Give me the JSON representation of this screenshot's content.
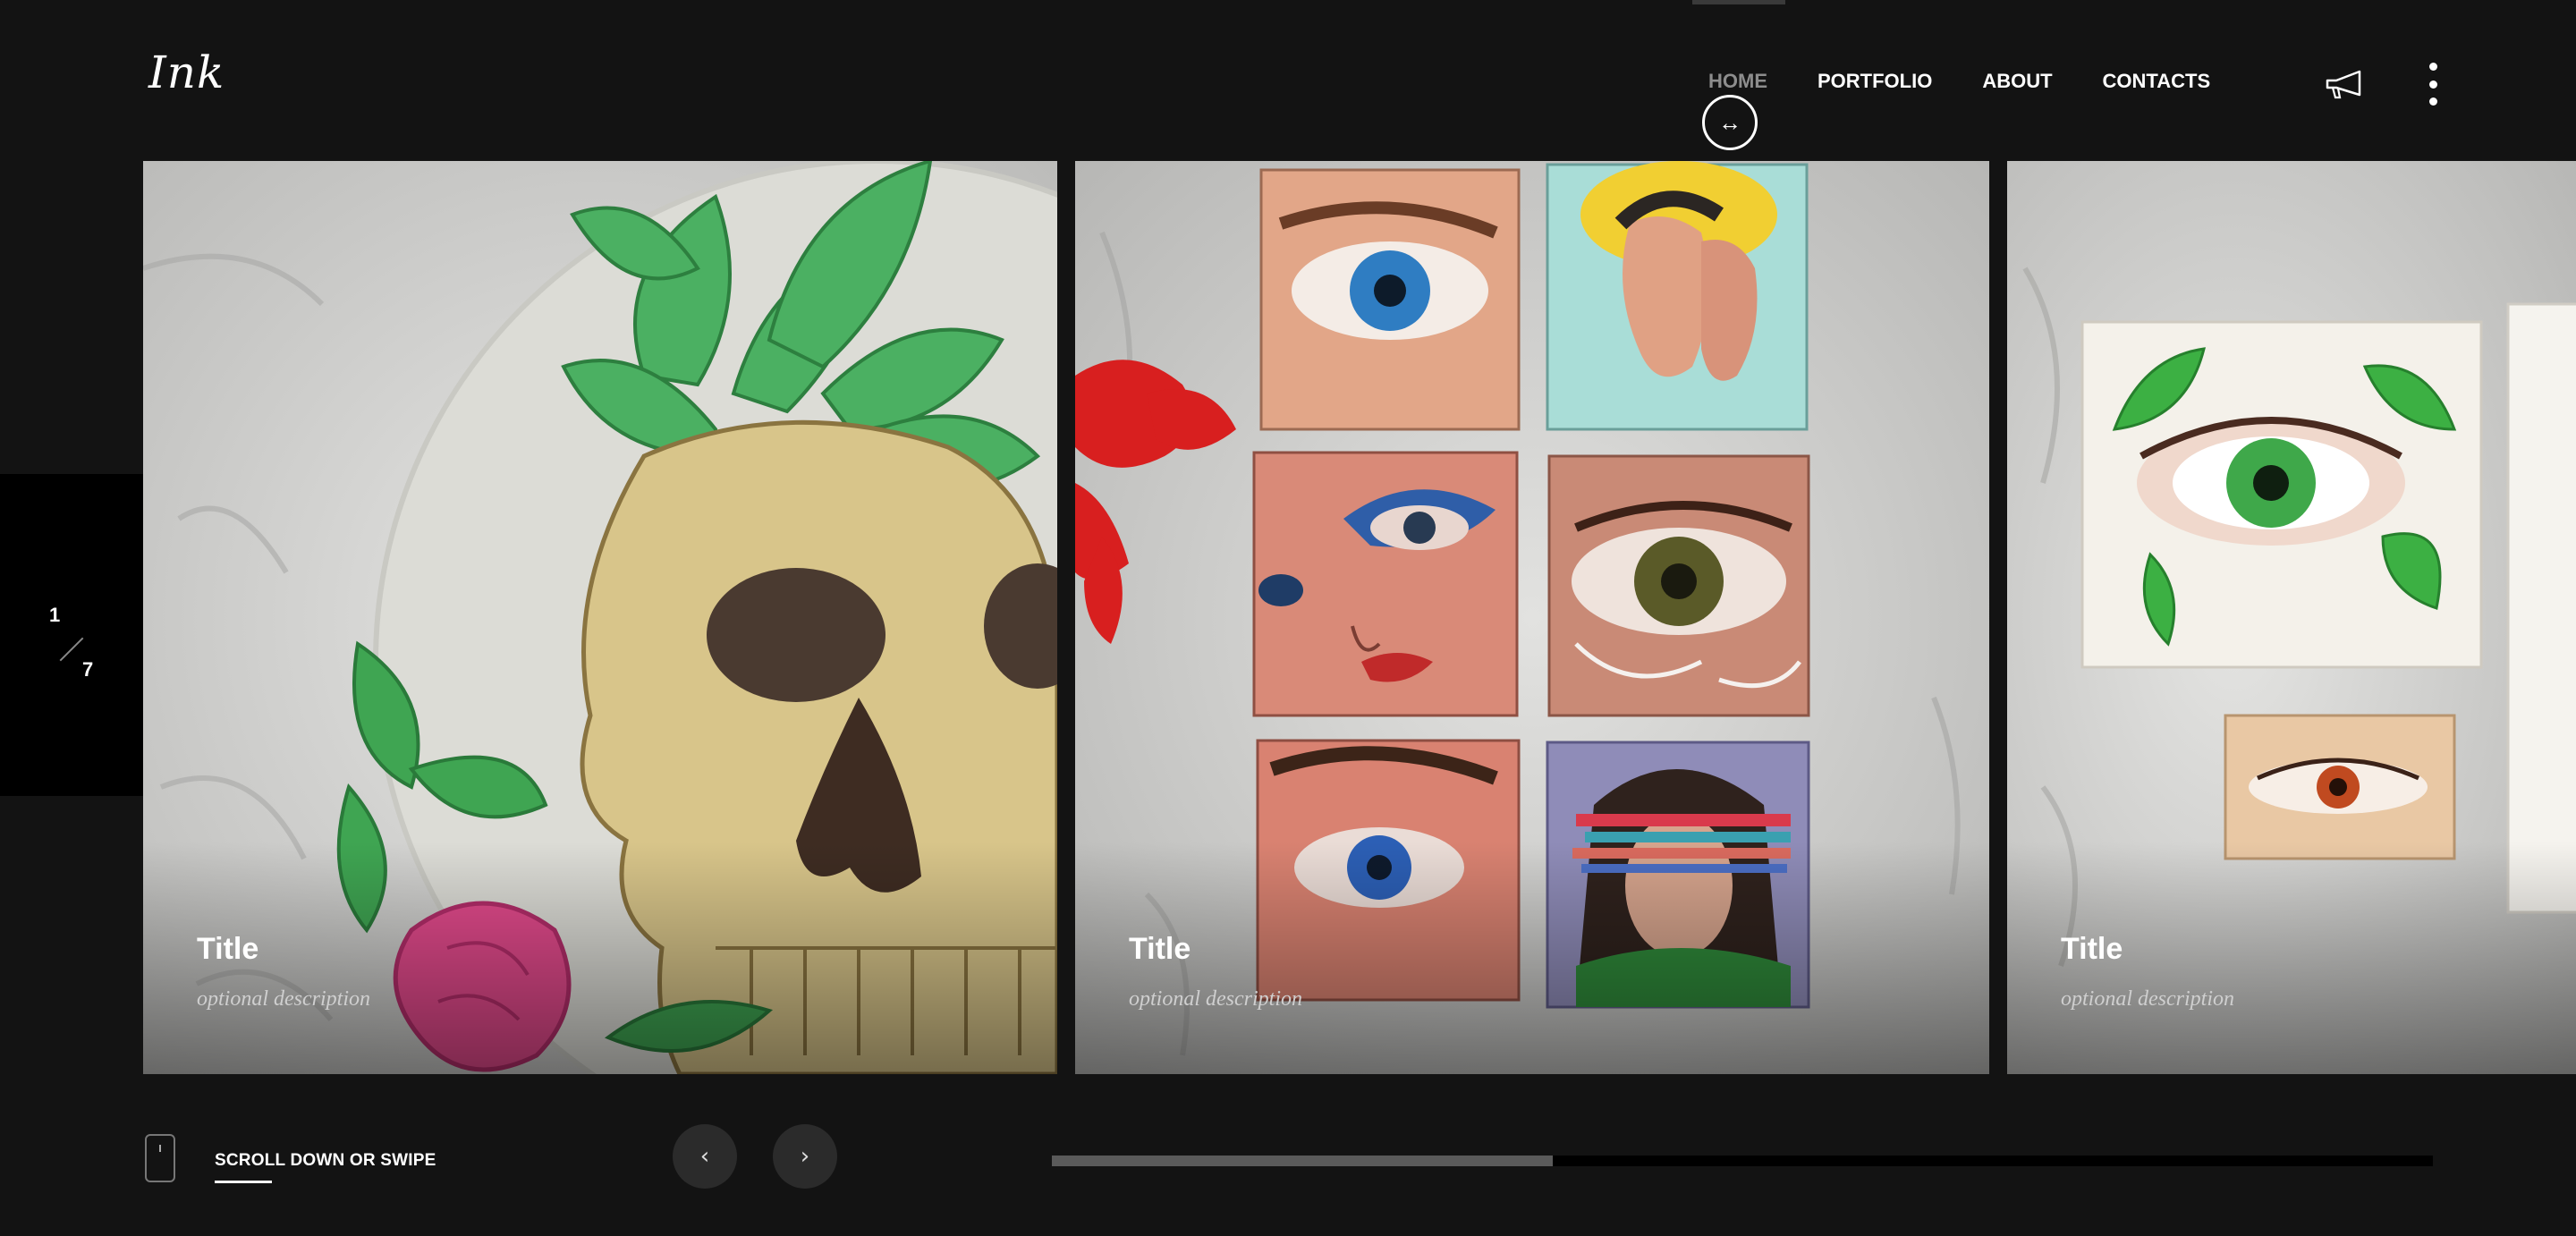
{
  "brand": {
    "logo": "Ink"
  },
  "nav": {
    "items": [
      {
        "label": "HOME",
        "active": true
      },
      {
        "label": "PORTFOLIO",
        "active": false
      },
      {
        "label": "ABOUT",
        "active": false
      },
      {
        "label": "CONTACTS",
        "active": false
      }
    ],
    "drag_cursor_glyph": "↔"
  },
  "counter": {
    "current": "1",
    "total": "7"
  },
  "slides": [
    {
      "title": "Title",
      "description": "optional description",
      "art": "skull-succulent-painting"
    },
    {
      "title": "Title",
      "description": "optional description",
      "art": "eyes-and-faces-mini-canvases"
    },
    {
      "title": "Title",
      "description": "optional description",
      "art": "green-eye-leaves-drawing"
    }
  ],
  "footer": {
    "scroll_hint": "SCROLL DOWN OR SWIPE",
    "prev_glyph": "‹",
    "next_glyph": "›",
    "progress": 0.363
  },
  "colors": {
    "background": "#131313",
    "nav_active": "#8d8d8d",
    "text": "#ffffff",
    "progress_fill": "#5a5a5a"
  },
  "icons": [
    "megaphone-icon",
    "kebab-menu-icon",
    "phone-swipe-icon",
    "drag-cursor-icon",
    "chevron-left-icon",
    "chevron-right-icon"
  ]
}
